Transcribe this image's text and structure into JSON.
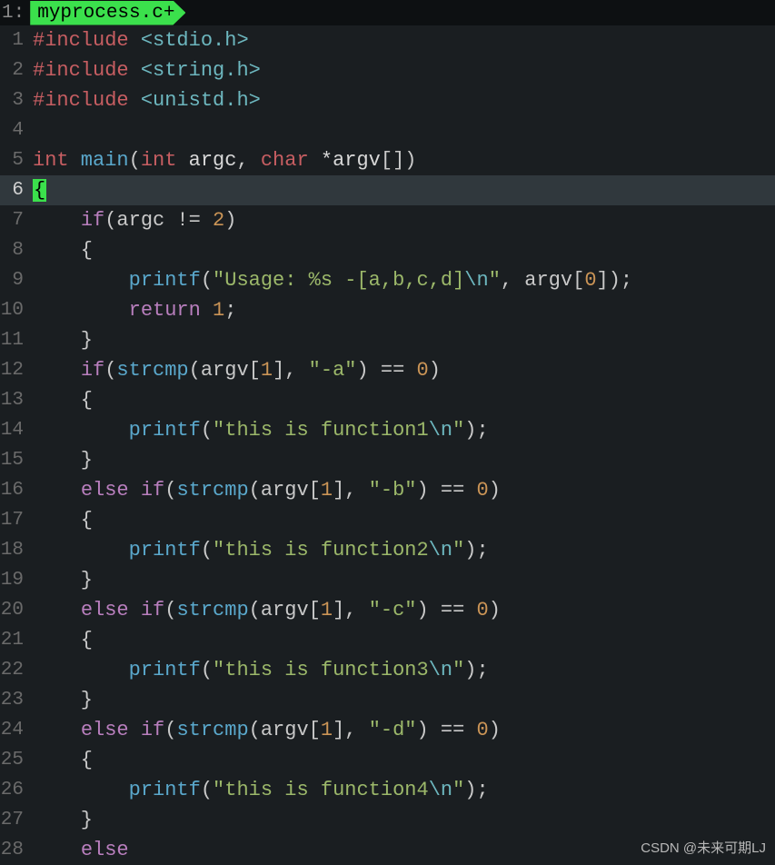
{
  "tab": {
    "index": "1:",
    "filename": "myprocess.c+"
  },
  "lines": {
    "l1_include": "#include",
    "l1_header": " <stdio.h>",
    "l2_include": "#include",
    "l2_header": " <string.h>",
    "l3_include": "#include",
    "l3_header": " <unistd.h>",
    "l5_int": "int",
    "l5_main": " main",
    "l5_p1": "(",
    "l5_int2": "int",
    "l5_argc": " argc",
    "l5_comma": ", ",
    "l5_char": "char",
    "l5_argv": " *argv",
    "l5_br": "[])",
    "l6_brace": "{",
    "l7_if": "if",
    "l7_p": "(argc != ",
    "l7_n": "2",
    "l7_cp": ")",
    "l8_brace": "    {",
    "l9_printf": "printf",
    "l9_p": "(",
    "l9_str": "\"Usage: %s -[a,b,c,d]",
    "l9_esc": "\\n",
    "l9_strend": "\"",
    "l9_comma": ", argv[",
    "l9_zero": "0",
    "l9_end": "]);",
    "l10_return": "return",
    "l10_space": " ",
    "l10_one": "1",
    "l10_semi": ";",
    "l11_cb": "    }",
    "l12_if": "if",
    "l12_p": "(",
    "l12_strcmp": "strcmp",
    "l12_args": "(argv[",
    "l12_1": "1",
    "l12_args2": "], ",
    "l12_str": "\"-a\"",
    "l12_cp": ") == ",
    "l12_zero": "0",
    "l12_end": ")",
    "l13_brace": "    {",
    "l14_printf": "printf",
    "l14_p": "(",
    "l14_str": "\"this is function1",
    "l14_esc": "\\n",
    "l14_strend": "\"",
    "l14_end": ");",
    "l15_cb": "    }",
    "l16_else": "else if",
    "l16_p": "(",
    "l16_strcmp": "strcmp",
    "l16_args": "(argv[",
    "l16_1": "1",
    "l16_args2": "], ",
    "l16_str": "\"-b\"",
    "l16_cp": ") == ",
    "l16_zero": "0",
    "l16_end": ")",
    "l17_brace": "    {",
    "l18_printf": "printf",
    "l18_p": "(",
    "l18_str": "\"this is function2",
    "l18_esc": "\\n",
    "l18_strend": "\"",
    "l18_end": ");",
    "l19_cb": "    }",
    "l20_else": "else if",
    "l20_p": "(",
    "l20_strcmp": "strcmp",
    "l20_args": "(argv[",
    "l20_1": "1",
    "l20_args2": "], ",
    "l20_str": "\"-c\"",
    "l20_cp": ") == ",
    "l20_zero": "0",
    "l20_end": ")",
    "l21_brace": "    {",
    "l22_printf": "printf",
    "l22_p": "(",
    "l22_str": "\"this is function3",
    "l22_esc": "\\n",
    "l22_strend": "\"",
    "l22_end": ");",
    "l23_cb": "    }",
    "l24_else": "else if",
    "l24_p": "(",
    "l24_strcmp": "strcmp",
    "l24_args": "(argv[",
    "l24_1": "1",
    "l24_args2": "], ",
    "l24_str": "\"-d\"",
    "l24_cp": ") == ",
    "l24_zero": "0",
    "l24_end": ")",
    "l25_brace": "    {",
    "l26_printf": "printf",
    "l26_p": "(",
    "l26_str": "\"this is function4",
    "l26_esc": "\\n",
    "l26_strend": "\"",
    "l26_end": ");",
    "l27_cb": "    }",
    "l28_else": "else"
  },
  "line_numbers": [
    "1",
    "2",
    "3",
    "4",
    "5",
    "6",
    "7",
    "8",
    "9",
    "10",
    "11",
    "12",
    "13",
    "14",
    "15",
    "16",
    "17",
    "18",
    "19",
    "20",
    "21",
    "22",
    "23",
    "24",
    "25",
    "26",
    "27",
    "28"
  ],
  "watermark": "CSDN @未来可期LJ"
}
